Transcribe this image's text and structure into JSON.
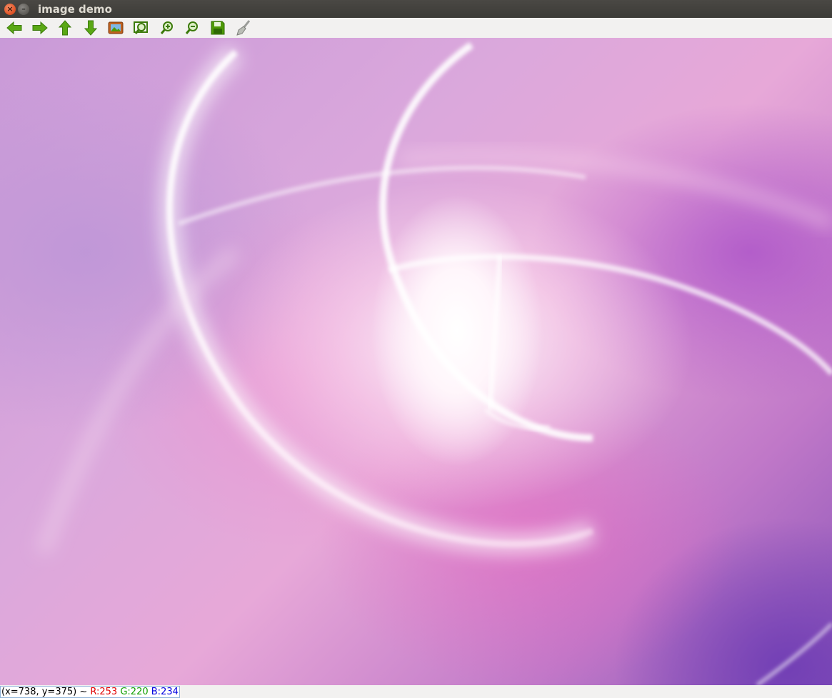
{
  "window": {
    "title": "image demo",
    "close_glyph": "×",
    "minimize_glyph": "–"
  },
  "toolbar": {
    "buttons": [
      {
        "name": "pan-left-button",
        "icon": "arrow-left-icon",
        "color": "#4e9a06"
      },
      {
        "name": "pan-right-button",
        "icon": "arrow-right-icon",
        "color": "#4e9a06"
      },
      {
        "name": "pan-up-button",
        "icon": "arrow-up-icon",
        "color": "#4e9a06"
      },
      {
        "name": "pan-down-button",
        "icon": "arrow-down-icon",
        "color": "#4e9a06"
      },
      {
        "name": "reset-zoom-button",
        "icon": "image-icon",
        "color": "#b4541a"
      },
      {
        "name": "zoom-to-fit-button",
        "icon": "zoom-region-icon",
        "color": "#4e9a06"
      },
      {
        "name": "zoom-in-button",
        "icon": "zoom-in-icon",
        "color": "#4e9a06"
      },
      {
        "name": "zoom-out-button",
        "icon": "zoom-out-icon",
        "color": "#4e9a06"
      },
      {
        "name": "save-button",
        "icon": "floppy-disk-icon",
        "color": "#4e9a06"
      },
      {
        "name": "properties-button",
        "icon": "brush-icon",
        "color": "#888a85"
      }
    ]
  },
  "canvas": {
    "description_colors": [
      "#c99ad8",
      "#e7a8d8",
      "#8a55b8",
      "#ffffff"
    ]
  },
  "status": {
    "coords": "(x=738, y=375) ~ ",
    "r": "R:253",
    "g": "G:220",
    "b": "B:234"
  }
}
